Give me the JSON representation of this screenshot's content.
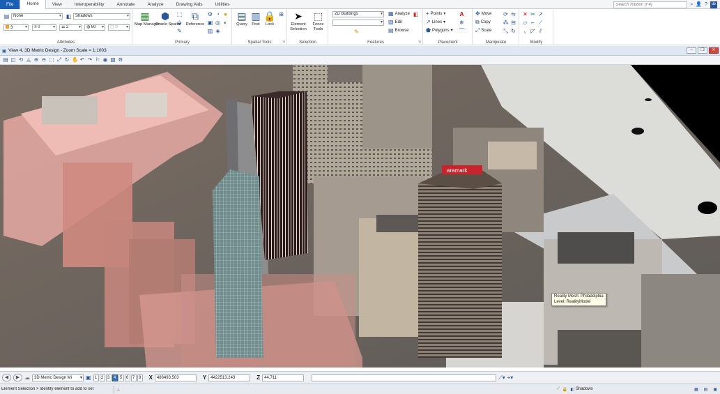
{
  "tabs": [
    "File",
    "Home",
    "View",
    "Interoperability",
    "Annotate",
    "Analyze",
    "Drawing Aids",
    "Utilities"
  ],
  "search_placeholder": "Search Ribbon (F4)",
  "attributes": {
    "level": "None",
    "display_style": "Shadows",
    "color": "3",
    "weight": "0",
    "style": "2",
    "transparency": "60",
    "priority": "0",
    "label": "Attributes"
  },
  "primary": {
    "map_manager": "Map Manager",
    "oracle_spatial": "Oracle Spatial",
    "reference": "Reference",
    "label": "Primary"
  },
  "spatial_tools": {
    "query": "Query",
    "post": "Post",
    "lock": "Lock",
    "label": "Spatial Tools"
  },
  "selection": {
    "element_selection": "Element Selection",
    "fence_tools": "Fence Tools",
    "label": "Selection"
  },
  "features": {
    "combo": "2D Buildings",
    "analyze": "Analyze",
    "edit": "Edit",
    "browse": "Browse",
    "label": "Features"
  },
  "placement": {
    "points": "Points",
    "lines": "Lines",
    "polygons": "Polygons",
    "label": "Placement"
  },
  "manipulate": {
    "move": "Move",
    "copy": "Copy",
    "scale": "Scale",
    "label": "Manipulate"
  },
  "modify": {
    "label": "Modify"
  },
  "view": {
    "title": "View 4, 3D Metric Design - Zoom Scale = 1:1003",
    "tooltip_line1": "Reality Mesh: Philadelphia",
    "tooltip_line2": "Level: RealityModel",
    "billboard": "aramark"
  },
  "coords": {
    "model": "3D Metric Design Mi",
    "view_numbers": [
      "1",
      "2",
      "3",
      "4",
      "5",
      "6",
      "7",
      "8"
    ],
    "active_view": "4",
    "x_label": "X",
    "x": "486493.503",
    "y_label": "Y",
    "y": "4422513.243",
    "z_label": "Z",
    "z": "44.711"
  },
  "status": {
    "prompt": "Element Selection > Identify element to add to set",
    "display_style": "Shadows"
  }
}
